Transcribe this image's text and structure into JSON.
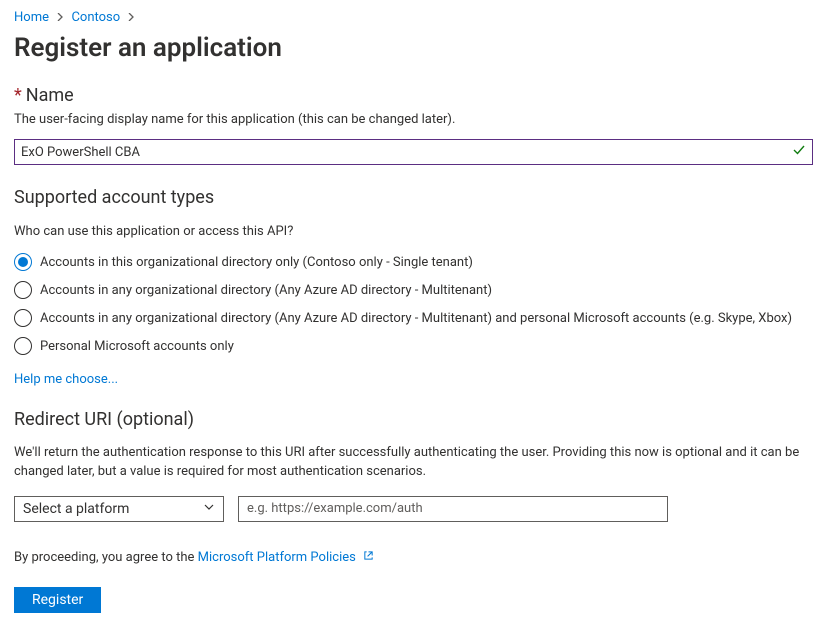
{
  "breadcrumb": {
    "items": [
      "Home",
      "Contoso"
    ]
  },
  "page_title": "Register an application",
  "name_section": {
    "label": "Name",
    "description": "The user-facing display name for this application (this can be changed later).",
    "value": "ExO PowerShell CBA"
  },
  "account_types": {
    "heading": "Supported account types",
    "question": "Who can use this application or access this API?",
    "options": [
      "Accounts in this organizational directory only (Contoso only - Single tenant)",
      "Accounts in any organizational directory (Any Azure AD directory - Multitenant)",
      "Accounts in any organizational directory (Any Azure AD directory - Multitenant) and personal Microsoft accounts (e.g. Skype, Xbox)",
      "Personal Microsoft accounts only"
    ],
    "selected_index": 0,
    "help_link": "Help me choose..."
  },
  "redirect": {
    "heading": "Redirect URI (optional)",
    "description": "We'll return the authentication response to this URI after successfully authenticating the user. Providing this now is optional and it can be changed later, but a value is required for most authentication scenarios.",
    "platform_placeholder": "Select a platform",
    "uri_placeholder": "e.g. https://example.com/auth"
  },
  "agree_prefix": "By proceeding, you agree to the ",
  "agree_link": "Microsoft Platform Policies",
  "register_button": "Register"
}
